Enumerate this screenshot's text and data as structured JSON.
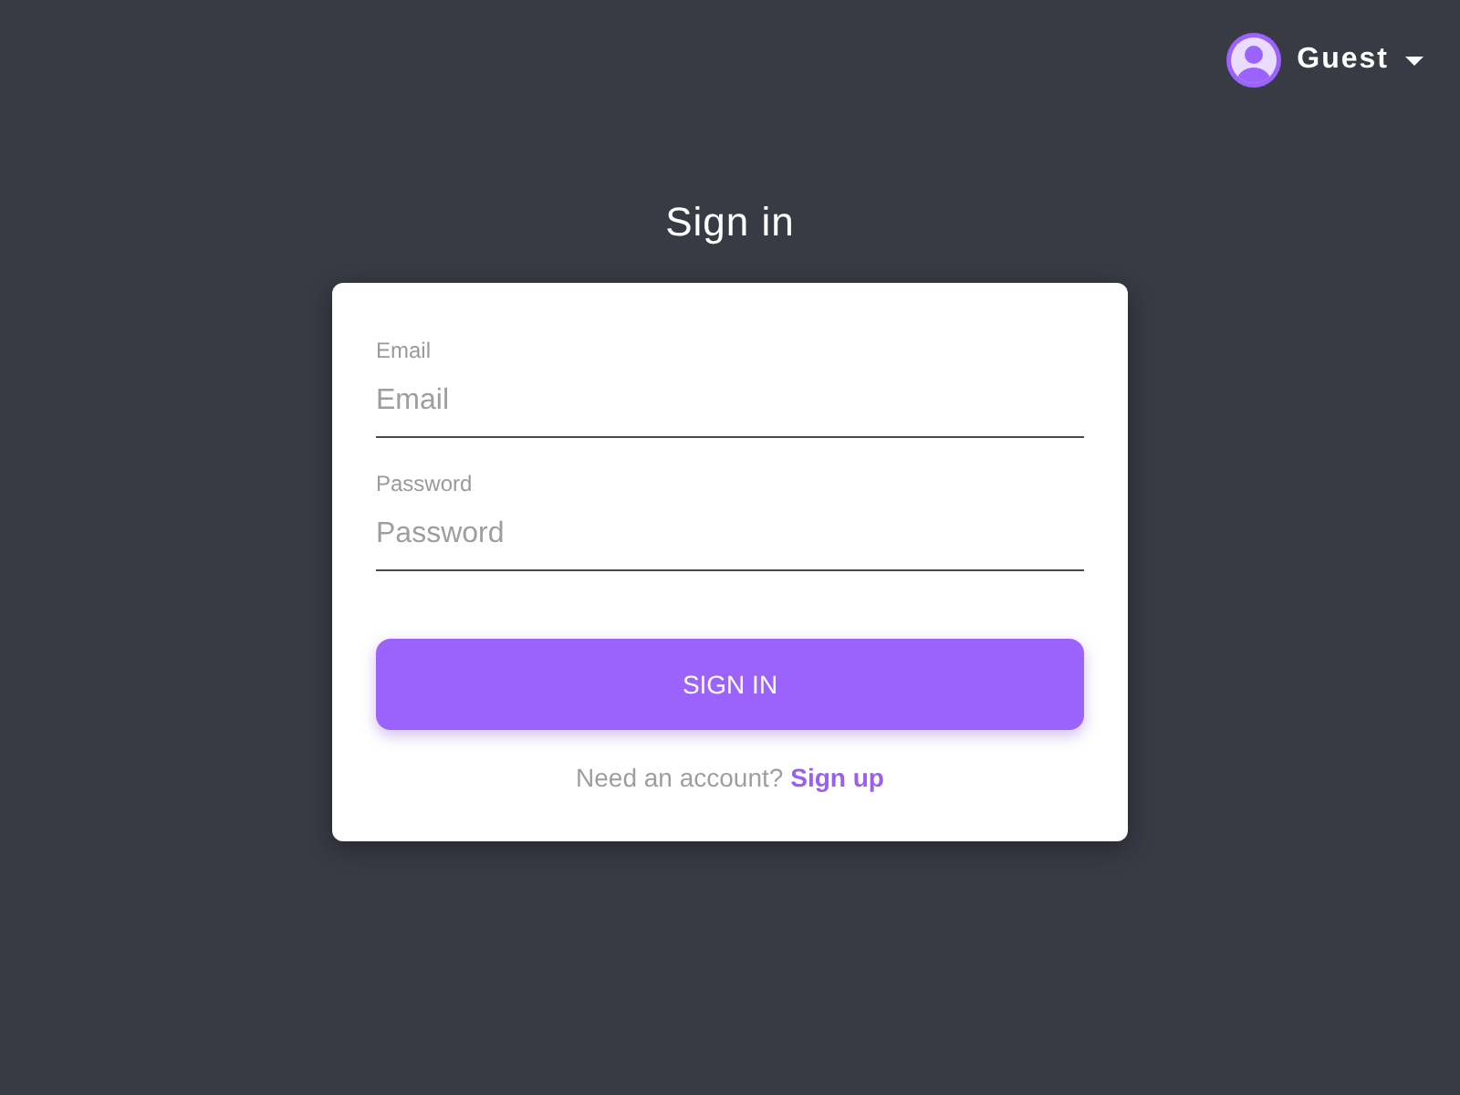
{
  "header": {
    "user": {
      "name": "Guest"
    }
  },
  "title": "Sign in",
  "form": {
    "fields": [
      {
        "label": "Email",
        "placeholder": "Email"
      },
      {
        "label": "Password",
        "placeholder": "Password"
      }
    ],
    "submit": "SIGN IN",
    "footer": {
      "text": "Need an account?",
      "link": "Sign up"
    }
  }
}
